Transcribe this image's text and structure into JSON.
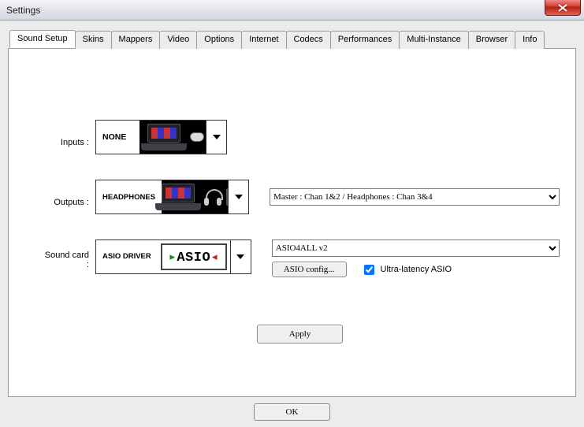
{
  "window": {
    "title": "Settings"
  },
  "tabs": [
    "Sound Setup",
    "Skins",
    "Mappers",
    "Video",
    "Options",
    "Internet",
    "Codecs",
    "Performances",
    "Multi-Instance",
    "Browser",
    "Info"
  ],
  "active_tab": 0,
  "sound_setup": {
    "inputs": {
      "label": "Inputs :",
      "picker_text": "NONE"
    },
    "outputs": {
      "label": "Outputs :",
      "picker_text": "HEADPHONES",
      "channel_select": "Master : Chan 1&2 / Headphones : Chan 3&4"
    },
    "soundcard": {
      "label": "Sound card :",
      "picker_text": "ASIO DRIVER",
      "device_select": "ASIO4ALL v2",
      "config_button": "ASIO config...",
      "ultra_latency_label": "Ultra-latency ASIO",
      "ultra_latency_checked": true
    },
    "apply_button": "Apply"
  },
  "footer": {
    "ok_button": "OK"
  }
}
